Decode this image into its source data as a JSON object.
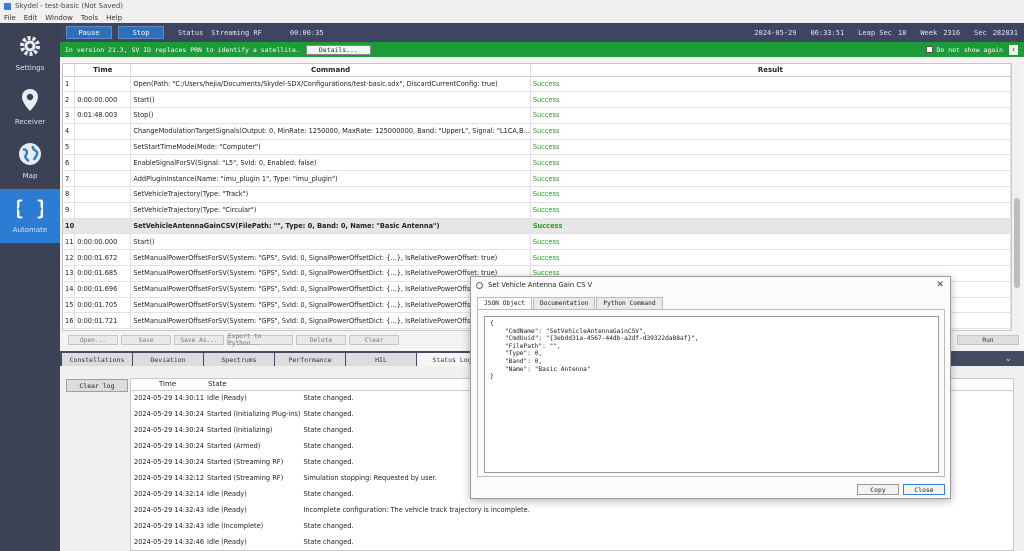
{
  "window": {
    "title": "Skydel - test-basic (Not Saved)"
  },
  "menu": [
    "File",
    "Edit",
    "Window",
    "Tools",
    "Help"
  ],
  "sidebar": {
    "items": [
      {
        "label": "Settings",
        "icon": "gear-icon"
      },
      {
        "label": "Receiver",
        "icon": "location-pin-icon"
      },
      {
        "label": "Map",
        "icon": "globe-icon"
      },
      {
        "label": "Automate",
        "icon": "braces-icon"
      }
    ],
    "active": "Automate"
  },
  "topbar": {
    "pause_label": "Pause",
    "stop_label": "Stop",
    "status_label": "Status",
    "status_value": "Streaming RF",
    "elapsed": "00:00:35",
    "date": "2024-05-29",
    "time": "06:33:51",
    "leap_label": "Leap Sec",
    "leap_value": "18",
    "week_label": "Week",
    "week_value": "2316",
    "sec_label": "Sec",
    "sec_value": "282831"
  },
  "banner": {
    "message": "In version 21.3, SV ID replaces PRN to identify a satellite.",
    "details_label": "Details...",
    "dont_show_label": "Do not show again",
    "colors": {
      "background": "#1e9a3a"
    }
  },
  "command_table": {
    "headers": {
      "time": "Time",
      "command": "Command",
      "result": "Result"
    },
    "selected_row": 10,
    "rows": [
      {
        "n": "1",
        "time": "",
        "command": "Open(Path: \"C:/Users/hejia/Documents/Skydel-SDX/Configurations/test-basic.sdx\", DiscardCurrentConfig: true)",
        "result": "Success"
      },
      {
        "n": "2",
        "time": "0:00:00.000",
        "command": "Start()",
        "result": "Success"
      },
      {
        "n": "3",
        "time": "0:01:48.003",
        "command": "Stop()",
        "result": "Success"
      },
      {
        "n": "4",
        "time": "",
        "command": "ChangeModulationTargetSignals(Output: 0, MinRate: 1250000, MaxRate: 125000000, Band: \"UpperL\", Signal: \"L1CA,B...",
        "result": "Success"
      },
      {
        "n": "5",
        "time": "",
        "command": "SetStartTimeMode(Mode: \"Computer\")",
        "result": "Success"
      },
      {
        "n": "6",
        "time": "",
        "command": "EnableSignalForSV(Signal: \"L5\", SvId: 0, Enabled: false)",
        "result": "Success"
      },
      {
        "n": "7",
        "time": "",
        "command": "AddPluginInstance(Name: \"imu_plugin 1\", Type: \"imu_plugin\")",
        "result": "Success"
      },
      {
        "n": "8",
        "time": "",
        "command": "SetVehicleTrajectory(Type: \"Track\")",
        "result": "Success"
      },
      {
        "n": "9",
        "time": "",
        "command": "SetVehicleTrajectory(Type: \"Circular\")",
        "result": "Success"
      },
      {
        "n": "10",
        "time": "",
        "command": "SetVehicleAntennaGainCSV(FilePath: \"\", Type: 0, Band: 0, Name: \"Basic Antenna\")",
        "result": "Success"
      },
      {
        "n": "11",
        "time": "0:00:00.000",
        "command": "Start()",
        "result": "Success"
      },
      {
        "n": "12",
        "time": "0:00:01.672",
        "command": "SetManualPowerOffsetForSV(System: \"GPS\", SvId: 0, SignalPowerOffsetDict: {...}, IsRelativePowerOffset: true)",
        "result": "Success"
      },
      {
        "n": "13",
        "time": "0:00:01.685",
        "command": "SetManualPowerOffsetForSV(System: \"GPS\", SvId: 0, SignalPowerOffsetDict: {...}, IsRelativePowerOffset: true)",
        "result": "Success"
      },
      {
        "n": "14",
        "time": "0:00:01.696",
        "command": "SetManualPowerOffsetForSV(System: \"GPS\", SvId: 0, SignalPowerOffsetDict: {...}, IsRelativePowerOffset: true)",
        "result": ""
      },
      {
        "n": "15",
        "time": "0:00:01.705",
        "command": "SetManualPowerOffsetForSV(System: \"GPS\", SvId: 0, SignalPowerOffsetDict: {...}, IsRelativePowerOffset: true)",
        "result": ""
      },
      {
        "n": "16",
        "time": "0:00:01.721",
        "command": "SetManualPowerOffsetForSV(System: \"GPS\", SvId: 0, SignalPowerOffsetDict: {...}, IsRelativePowerOffset: true)",
        "result": ""
      }
    ]
  },
  "actions": [
    "Open...",
    "Save",
    "Save As...",
    "Export to Python...",
    "Delete",
    "Clear"
  ],
  "run_label": "Run",
  "bottom_tabs": [
    "Constellations",
    "Deviation",
    "Spectrums",
    "Performance",
    "HIL",
    "Status Log"
  ],
  "active_bottom_tab": "Status Log",
  "clear_log_label": "Clear log",
  "log_table": {
    "headers": {
      "time": "Time",
      "state": "State"
    },
    "rows": [
      {
        "time": "2024-05-29 14:30:11",
        "state": "Idle (Ready)",
        "msg": "State changed."
      },
      {
        "time": "2024-05-29 14:30:24",
        "state": "Started (Initializing Plug-ins)",
        "msg": "State changed."
      },
      {
        "time": "2024-05-29 14:30:24",
        "state": "Started (Initializing)",
        "msg": "State changed."
      },
      {
        "time": "2024-05-29 14:30:24",
        "state": "Started (Armed)",
        "msg": "State changed."
      },
      {
        "time": "2024-05-29 14:30:24",
        "state": "Started (Streaming RF)",
        "msg": "State changed."
      },
      {
        "time": "2024-05-29 14:32:12",
        "state": "Started (Streaming RF)",
        "msg": "Simulation stopping: Requested by user."
      },
      {
        "time": "2024-05-29 14:32:14",
        "state": "Idle (Ready)",
        "msg": "State changed."
      },
      {
        "time": "2024-05-29 14:32:43",
        "state": "Idle (Ready)",
        "msg": "Incomplete configuration: The vehicle track trajectory is incomplete."
      },
      {
        "time": "2024-05-29 14:32:43",
        "state": "Idle (Incomplete)",
        "msg": "State changed."
      },
      {
        "time": "2024-05-29 14:32:46",
        "state": "Idle (Ready)",
        "msg": "State changed."
      }
    ]
  },
  "dialog": {
    "title": "Set Vehicle Antenna Gain CS V",
    "tabs": [
      "JSON Object",
      "Documentation",
      "Python Command"
    ],
    "active_tab": "JSON Object",
    "json_text": "{\n    \"CmdName\": \"SetVehicleAntennaGainCSV\",\n    \"CmdUuid\": \"{3ebdd31a-4567-44db-a2df-d39322da88af}\",\n    \"FilePath\": \"\",\n    \"Type\": 0,\n    \"Band\": 0,\n    \"Name\": \"Basic Antenna\"\n}",
    "copy_label": "Copy",
    "close_label": "Close"
  }
}
